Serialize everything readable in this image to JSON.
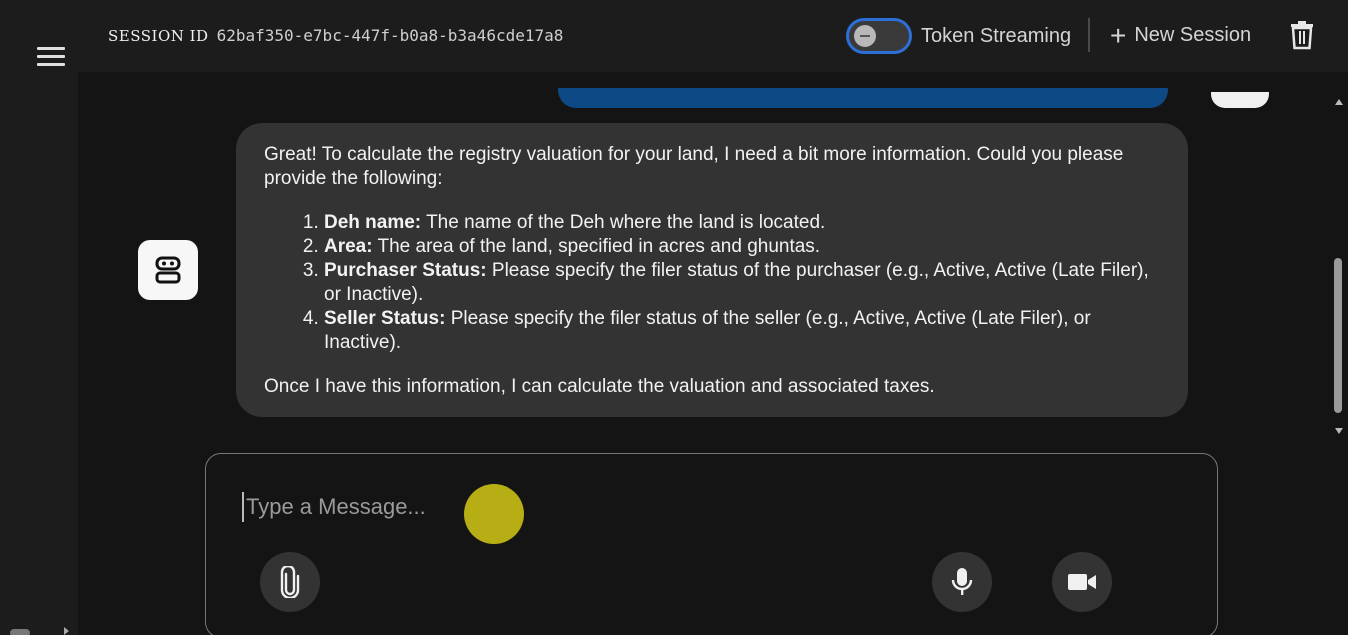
{
  "header": {
    "session_label": "SESSION ID",
    "session_id": "62baf350-e7bc-447f-b0a8-b3a46cde17a8",
    "token_streaming_label": "Token Streaming",
    "token_streaming_enabled": false,
    "new_session_label": "New Session"
  },
  "message": {
    "intro": "Great! To calculate the registry valuation for your land, I need a bit more information. Could you please provide the following:",
    "items": [
      {
        "title": "Deh name:",
        "text": " The name of the Deh where the land is located."
      },
      {
        "title": "Area:",
        "text": " The area of the land, specified in acres and ghuntas."
      },
      {
        "title": "Purchaser Status:",
        "text": " Please specify the filer status of the purchaser (e.g., Active, Active (Late Filer), or Inactive)."
      },
      {
        "title": "Seller Status:",
        "text": " Please specify the filer status of the seller (e.g., Active, Active (Late Filer), or Inactive)."
      }
    ],
    "outro": "Once I have this information, I can calculate the valuation and associated taxes."
  },
  "composer": {
    "placeholder": "Type a Message...",
    "value": ""
  },
  "icons": {
    "menu": "hamburger-menu-icon",
    "trash": "trash-icon",
    "bot": "robot-icon",
    "attach": "paperclip-icon",
    "mic": "microphone-icon",
    "video": "video-camera-icon"
  },
  "colors": {
    "toggle_border": "#2c6fd6",
    "user_bubble": "#0d4a85",
    "bot_bubble": "#333333",
    "cursor_highlight": "#d4c814"
  }
}
